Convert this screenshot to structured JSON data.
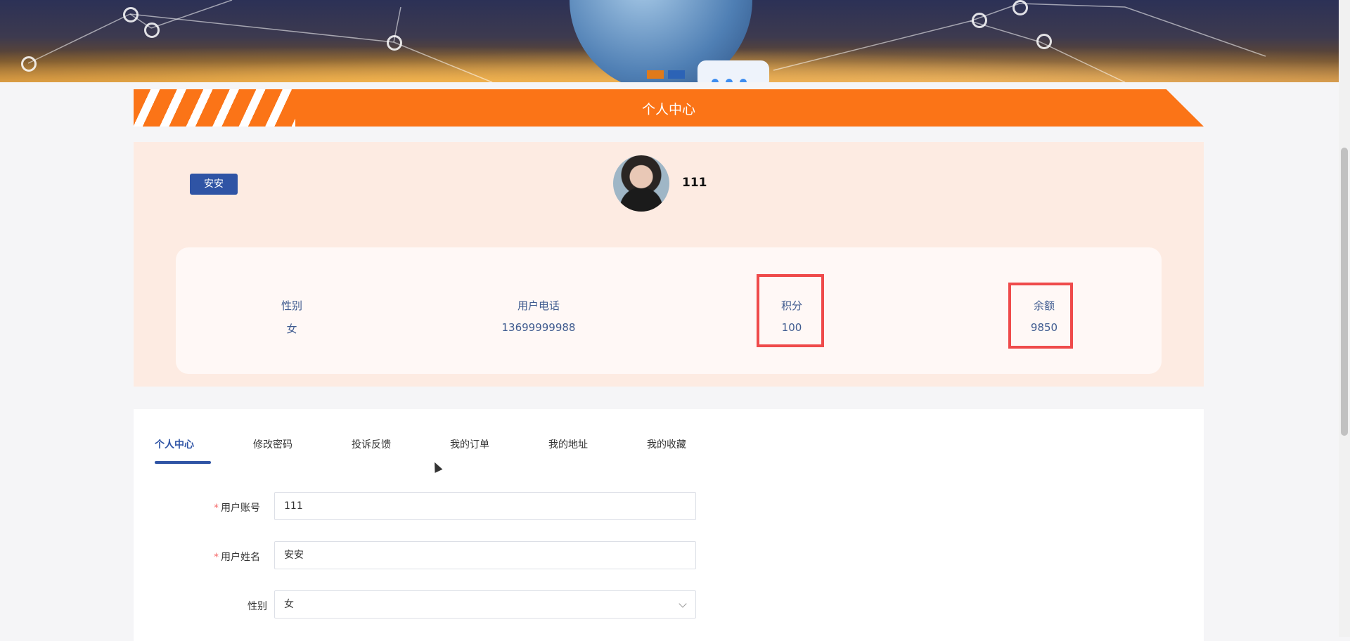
{
  "header": {
    "title": "个人中心"
  },
  "profile": {
    "name_badge": "安安",
    "username": "111"
  },
  "stats": [
    {
      "label": "性别",
      "value": "女"
    },
    {
      "label": "用户电话",
      "value": "13699999988"
    },
    {
      "label": "积分",
      "value": "100"
    },
    {
      "label": "余额",
      "value": "9850"
    }
  ],
  "tabs": [
    {
      "label": "个人中心",
      "active": true
    },
    {
      "label": "修改密码",
      "active": false
    },
    {
      "label": "投诉反馈",
      "active": false
    },
    {
      "label": "我的订单",
      "active": false
    },
    {
      "label": "我的地址",
      "active": false
    },
    {
      "label": "我的收藏",
      "active": false
    }
  ],
  "form": {
    "account": {
      "required_mark": "*",
      "label": "用户账号",
      "value": "111"
    },
    "name": {
      "required_mark": "*",
      "label": "用户姓名",
      "value": "安安"
    },
    "gender": {
      "label": "性别",
      "value": "女"
    }
  },
  "colors": {
    "accent_orange": "#fb7417",
    "primary_blue": "#2f54a5",
    "highlight_red": "#ef4b4b",
    "panel_peach": "#fdebe2"
  }
}
